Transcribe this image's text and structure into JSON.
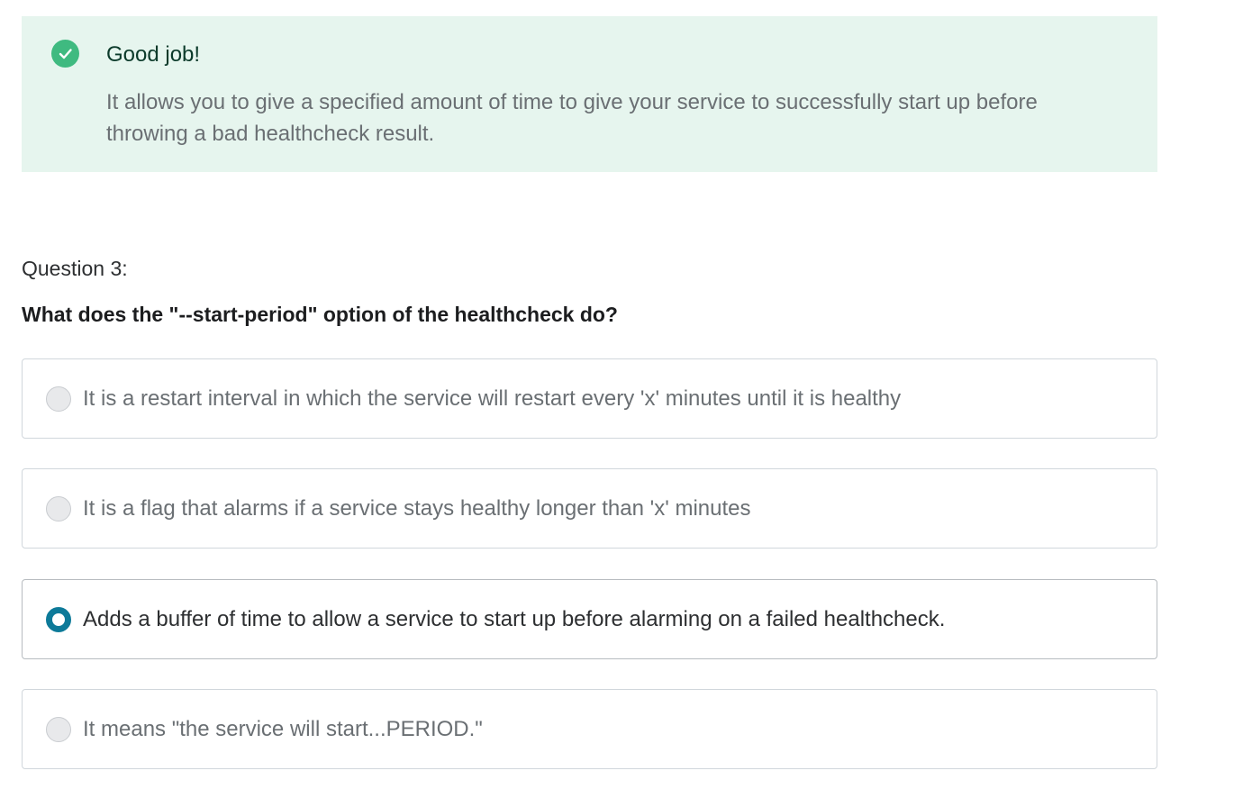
{
  "feedback": {
    "icon": "check-circle-icon",
    "status_color": "#3fba80",
    "title": "Good job!",
    "text": "It allows you to give a specified amount of time to give your service to successfully start up before throwing a bad healthcheck result."
  },
  "question": {
    "number_label": "Question 3:",
    "text": "What does the \"--start-period\" option of the healthcheck do?"
  },
  "options": [
    {
      "label": "It is a restart interval in which the service will restart every 'x' minutes until it is healthy",
      "selected": false
    },
    {
      "label": "It is a flag that alarms if a service stays healthy longer than 'x' minutes",
      "selected": false
    },
    {
      "label": "Adds a buffer of time to allow a service to start up before alarming on a failed healthcheck.",
      "selected": true
    },
    {
      "label": "It means \"the service will start...PERIOD.\"",
      "selected": false
    }
  ],
  "accent_color": "#0d7a99"
}
